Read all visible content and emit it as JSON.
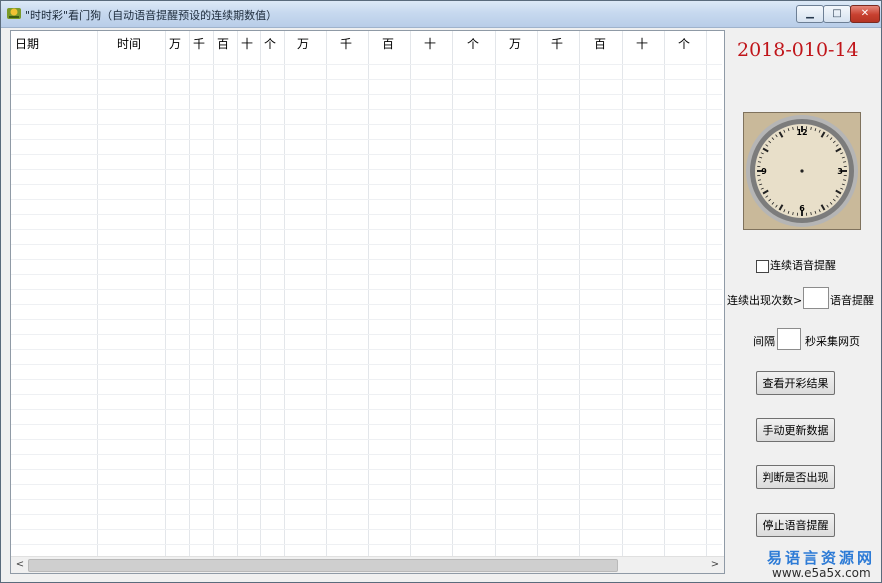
{
  "window": {
    "title": "\"时时彩\"看门狗（自动语音提醒预设的连续期数值）",
    "min_symbol": "▁",
    "max_symbol": "□",
    "close_symbol": "✕"
  },
  "grid": {
    "columns": [
      "日期",
      "时间",
      "万",
      "千",
      "百",
      "十",
      "个",
      "万",
      "千",
      "百",
      "十",
      "个",
      "万",
      "千",
      "百",
      "十",
      "个"
    ],
    "rows": []
  },
  "date_display": "2018-010-14",
  "clock": {
    "numbers": [
      "12",
      "3",
      "6",
      "9"
    ],
    "colors": {
      "face": "#e8dfc9",
      "bezel": "#9a9a9a",
      "background": "#c9b99a"
    }
  },
  "options": {
    "voice_checkbox_label": "连续语音提醒",
    "voice_checked": false,
    "threshold_prefix": "连续出现次数>=",
    "threshold_value": "",
    "threshold_suffix": "语音提醒",
    "interval_prefix": "间隔",
    "interval_value": "",
    "interval_suffix": "秒采集网页"
  },
  "buttons": {
    "view_results": "查看开彩结果",
    "manual_update": "手动更新数据",
    "check_appear": "判断是否出现",
    "stop_voice": "停止语音提醒"
  },
  "scrollbar": {
    "left_arrow": "<",
    "right_arrow": ">"
  },
  "watermark": {
    "line1": "易语言资源网",
    "line2": "www.e5a5x.com"
  },
  "colors": {
    "date_red": "#c0151a",
    "titlebar": "#c7d9ef",
    "watermark_blue": "#2d7bd6"
  }
}
